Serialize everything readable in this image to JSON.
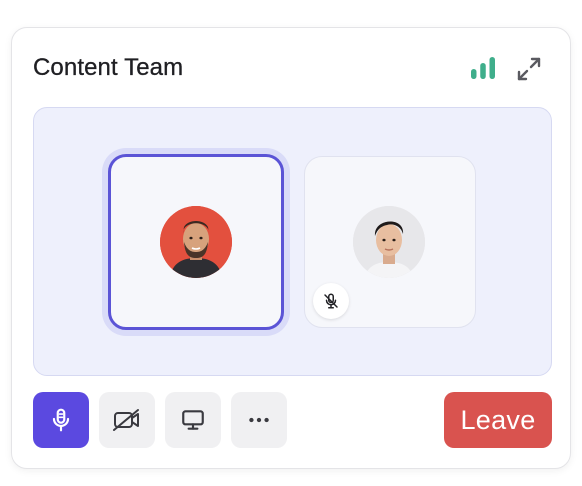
{
  "header": {
    "title": "Content Team",
    "signal_icon": "signal-bars-icon",
    "expand_icon": "expand-icon"
  },
  "participants": [
    {
      "role": "speaking",
      "avatar_bg": "#e3503e",
      "muted": false
    },
    {
      "role": "participant",
      "avatar_bg": "#e7e7ea",
      "muted": true
    }
  ],
  "controls": {
    "mic_icon": "microphone-icon",
    "camera_icon": "camera-off-icon",
    "screen_icon": "screen-share-icon",
    "more_icon": "more-icon",
    "leave_label": "Leave"
  },
  "colors": {
    "accent": "#5b49e0",
    "signal": "#3fae8b",
    "leave": "#d9534f",
    "stage_bg": "#eef0fc"
  }
}
